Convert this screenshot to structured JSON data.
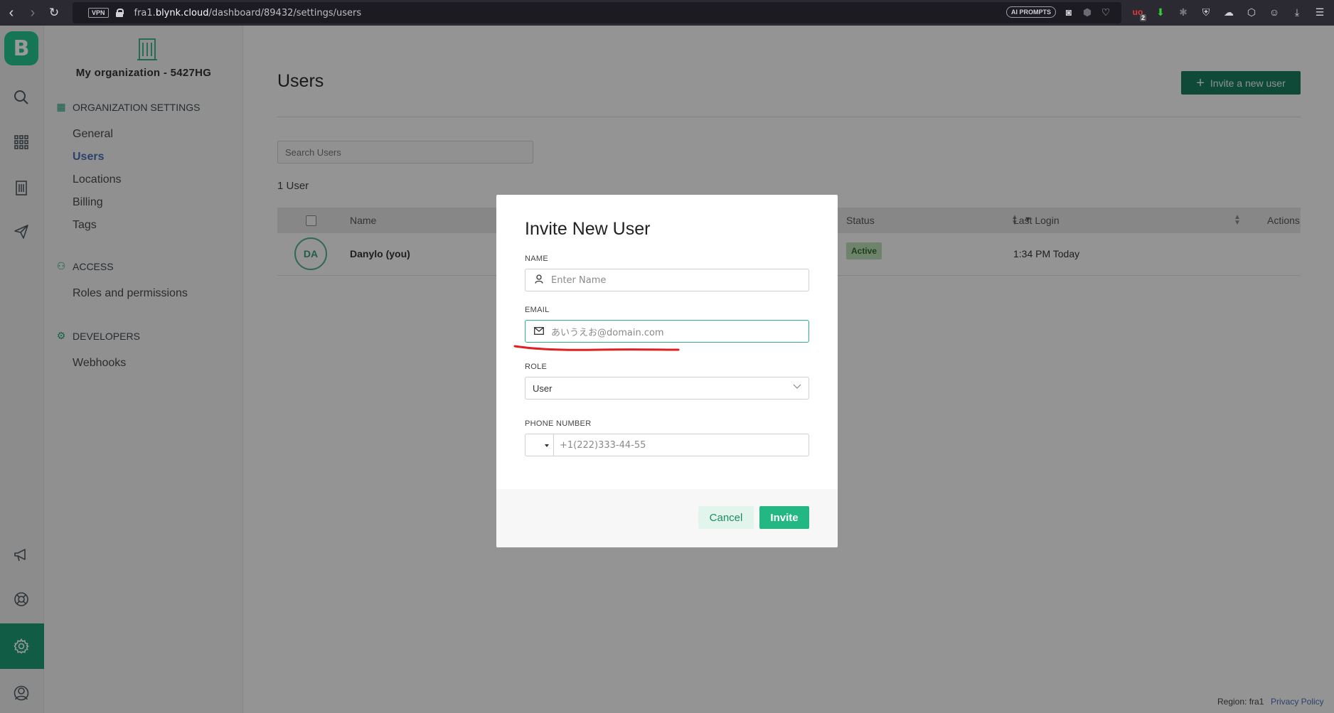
{
  "browser": {
    "url_prefix": "fra1.",
    "url_domain": "blynk.cloud",
    "url_path": "/dashboard/89432/settings/users",
    "vpn_label": "VPN",
    "ai_prompts_label": "AI PROMPTS",
    "ublock_badge": "2"
  },
  "sidebar": {
    "org_name": "My organization - 5427HG",
    "sections": [
      {
        "title": "ORGANIZATION SETTINGS",
        "items": [
          "General",
          "Users",
          "Locations",
          "Billing",
          "Tags"
        ]
      },
      {
        "title": "ACCESS",
        "items": [
          "Roles and permissions"
        ]
      },
      {
        "title": "DEVELOPERS",
        "items": [
          "Webhooks"
        ]
      }
    ],
    "active_item": "Users",
    "logo_letter": "B"
  },
  "main": {
    "title": "Users",
    "invite_button": "Invite a new user",
    "search_placeholder": "Search Users",
    "count_text": "1 User",
    "columns": [
      "Name",
      "Status",
      "Last Login",
      "Actions"
    ],
    "rows": [
      {
        "initials": "DA",
        "name": "Danylo (you)",
        "status": "Active",
        "last_login": "1:34 PM Today"
      }
    ]
  },
  "footer": {
    "region": "Region: fra1",
    "privacy": "Privacy Policy"
  },
  "modal": {
    "title": "Invite New User",
    "name_label": "NAME",
    "name_placeholder": "Enter Name",
    "email_label": "EMAIL",
    "email_placeholder": "あいうえお@domain.com",
    "role_label": "ROLE",
    "role_value": "User",
    "phone_label": "PHONE NUMBER",
    "phone_placeholder": "+1(222)333-44-55",
    "cancel": "Cancel",
    "invite": "Invite"
  },
  "colors": {
    "brand": "#23c48e",
    "primary_button": "#1a7a5c",
    "annotation": "#e02020"
  }
}
